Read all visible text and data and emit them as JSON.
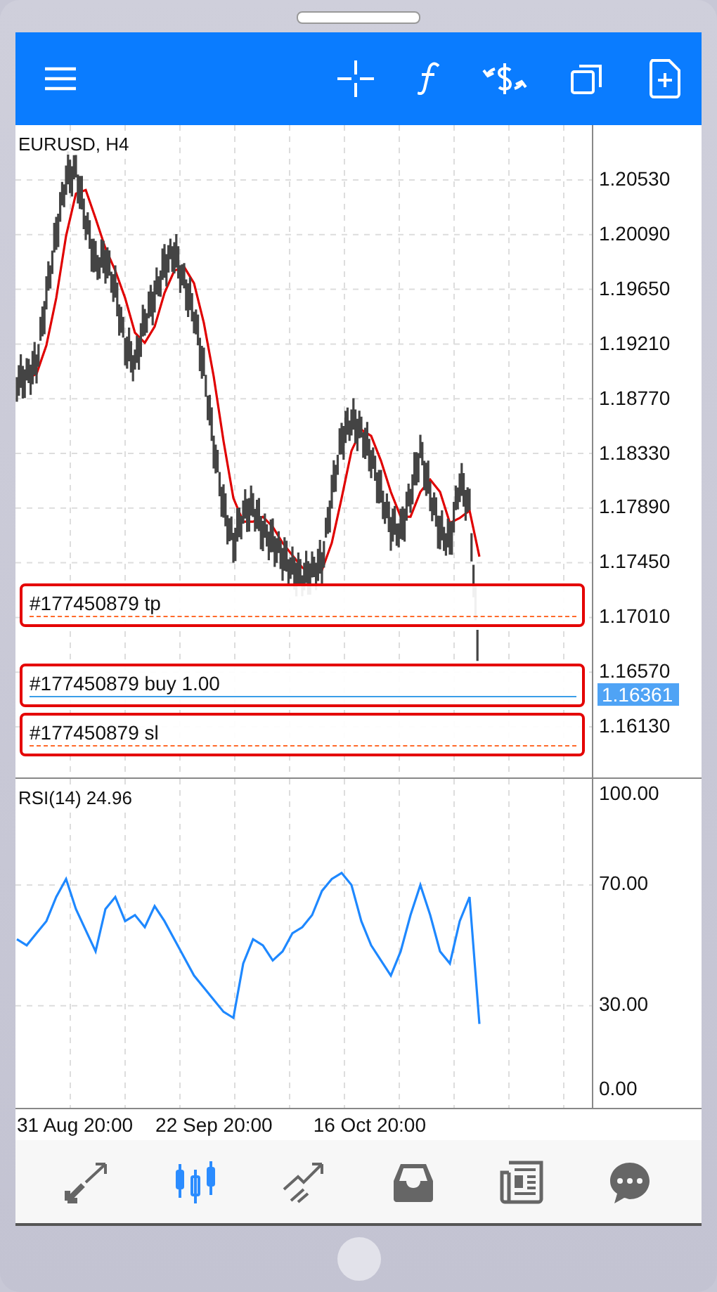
{
  "chart": {
    "title": "EURUSD, H4",
    "chart_data": {
      "type": "line",
      "grid": true,
      "ylim": [
        1.15723,
        1.20971
      ],
      "yticks": [
        {
          "value": 1.2053,
          "label": "1.20530"
        },
        {
          "value": 1.2009,
          "label": "1.20090"
        },
        {
          "value": 1.1965,
          "label": "1.19650"
        },
        {
          "value": 1.1921,
          "label": "1.19210"
        },
        {
          "value": 1.1877,
          "label": "1.18770"
        },
        {
          "value": 1.1833,
          "label": "1.18330"
        },
        {
          "value": 1.1789,
          "label": "1.17890"
        },
        {
          "value": 1.1745,
          "label": "1.17450"
        },
        {
          "value": 1.1701,
          "label": "1.17010"
        },
        {
          "value": 1.1657,
          "label": "1.16570"
        },
        {
          "value": 1.1613,
          "label": "1.16130"
        }
      ],
      "series": [
        {
          "color": "#e00000",
          "values": [
            1.1891,
            1.1893,
            1.1897,
            1.192,
            1.1958,
            1.2008,
            1.2042,
            1.2045,
            1.2022,
            1.1998,
            1.198,
            1.1958,
            1.193,
            1.1922,
            1.1935,
            1.1962,
            1.198,
            1.1983,
            1.197,
            1.1938,
            1.1895,
            1.1843,
            1.1797,
            1.1778,
            1.1778,
            1.1782,
            1.1774,
            1.1761,
            1.1751,
            1.1741,
            1.1737,
            1.1739,
            1.1761,
            1.1797,
            1.1835,
            1.1852,
            1.1847,
            1.1827,
            1.1802,
            1.1782,
            1.1782,
            1.1802,
            1.1812,
            1.1802,
            1.1777,
            1.1781,
            1.1787,
            1.175
          ]
        }
      ]
    },
    "current_price": "1.16361",
    "orders": [
      {
        "kind": "tp",
        "label": "#177450879 tp"
      },
      {
        "kind": "buy",
        "label": "#177450879 buy 1.00"
      },
      {
        "kind": "sl",
        "label": "#177450879 sl"
      }
    ]
  },
  "rsi": {
    "title": "RSI(14) 24.96",
    "chart_data": {
      "type": "line",
      "grid": true,
      "ylim": [
        -6.59,
        105.12
      ],
      "yticks": [
        {
          "value": 100,
          "label": "100.00"
        },
        {
          "value": 70,
          "label": "70.00"
        },
        {
          "value": 30,
          "label": "30.00"
        },
        {
          "value": 0,
          "label": "0.00"
        }
      ],
      "series": [
        {
          "color": "#1e88ff",
          "values": [
            52,
            50,
            54,
            58,
            66,
            72,
            62,
            55,
            48,
            62,
            66,
            58,
            60,
            56,
            63,
            58,
            52,
            46,
            40,
            36,
            32,
            28,
            26,
            44,
            52,
            50,
            45,
            48,
            54,
            56,
            60,
            68,
            72,
            74,
            70,
            58,
            50,
            45,
            40,
            48,
            60,
            70,
            60,
            48,
            44,
            58,
            66,
            24
          ]
        }
      ]
    }
  },
  "time_axis": [
    "31 Aug 20:00",
    "22 Sep 20:00",
    "16 Oct 20:00"
  ],
  "nav": [
    {
      "kind": "quotes",
      "selected": false
    },
    {
      "kind": "chart",
      "selected": true
    },
    {
      "kind": "trade",
      "selected": false
    },
    {
      "kind": "history",
      "selected": false
    },
    {
      "kind": "news",
      "selected": false
    },
    {
      "kind": "chat",
      "selected": false
    }
  ]
}
